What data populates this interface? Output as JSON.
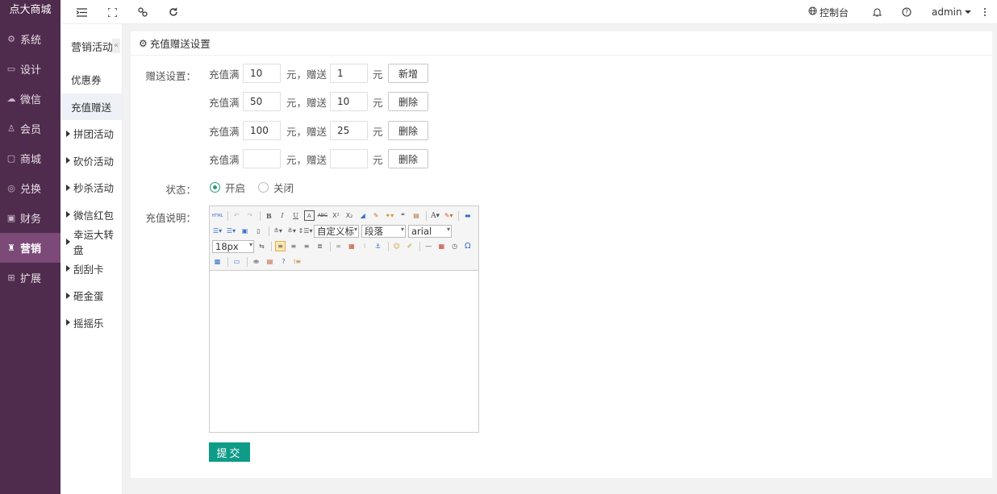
{
  "app": {
    "logo": "点大商城"
  },
  "main_nav": [
    {
      "label": "系统",
      "icon": "gear-icon",
      "glyph": "⚙"
    },
    {
      "label": "设计",
      "icon": "design-icon",
      "glyph": "▭"
    },
    {
      "label": "微信",
      "icon": "wechat-icon",
      "glyph": "☁"
    },
    {
      "label": "会员",
      "icon": "member-icon",
      "glyph": "♙"
    },
    {
      "label": "商城",
      "icon": "mall-icon",
      "glyph": "▢"
    },
    {
      "label": "兑换",
      "icon": "exchange-icon",
      "glyph": "◎"
    },
    {
      "label": "财务",
      "icon": "finance-icon",
      "glyph": "▣"
    },
    {
      "label": "营销",
      "icon": "marketing-icon",
      "glyph": "♜"
    },
    {
      "label": "扩展",
      "icon": "extend-icon",
      "glyph": "⊞"
    }
  ],
  "topbar": {
    "console_label": "控制台",
    "user": "admin"
  },
  "sub_nav": {
    "title": "营销活动",
    "collapse_glyph": "«",
    "items": [
      {
        "label": "优惠券"
      },
      {
        "label": "充值赠送"
      },
      {
        "label": "拼团活动"
      },
      {
        "label": "砍价活动"
      },
      {
        "label": "秒杀活动"
      },
      {
        "label": "微信红包"
      },
      {
        "label": "幸运大转盘"
      },
      {
        "label": "刮刮卡"
      },
      {
        "label": "砸金蛋"
      },
      {
        "label": "摇摇乐"
      }
    ]
  },
  "card": {
    "title": "充值赠送设置",
    "gift_label": "赠送设置：",
    "recharge_text": "充值满",
    "yuan_gift_text": "元，赠送",
    "yuan_text": "元",
    "rules": [
      {
        "recharge": "10",
        "gift": "1",
        "button": "新增"
      },
      {
        "recharge": "50",
        "gift": "10",
        "button": "删除"
      },
      {
        "recharge": "100",
        "gift": "25",
        "button": "删除"
      },
      {
        "recharge": "",
        "gift": "",
        "button": "删除"
      }
    ],
    "status_label": "状态：",
    "status_on": "开启",
    "status_off": "关闭",
    "desc_label": "充值说明：",
    "editor": {
      "custom_title": "自定义标",
      "paragraph": "段落",
      "font": "arial",
      "size": "18px"
    },
    "submit": "提交"
  },
  "colors": {
    "sidebar": "#4f2c4d",
    "active": "#7b4a78",
    "submit": "#0e9b87",
    "radio": "#2b9a7a"
  }
}
